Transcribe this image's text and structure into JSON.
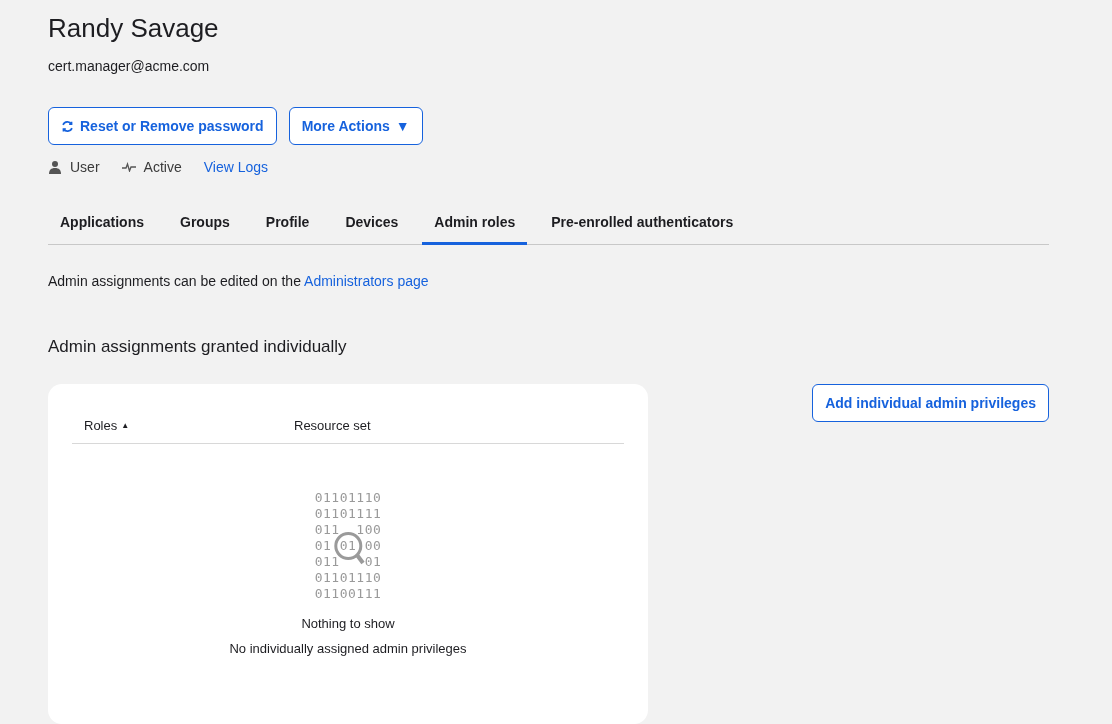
{
  "user": {
    "name": "Randy Savage",
    "email": "cert.manager@acme.com"
  },
  "actions": [
    {
      "kind": "reset",
      "label": "Reset or Remove password"
    },
    {
      "kind": "menu",
      "label": "More Actions",
      "caret": "▼"
    }
  ],
  "status": {
    "type": "User",
    "state": "Active",
    "logs_link": "View Logs"
  },
  "tabs": [
    {
      "label": "Applications",
      "selected": false
    },
    {
      "label": "Groups",
      "selected": false
    },
    {
      "label": "Profile",
      "selected": false
    },
    {
      "label": "Devices",
      "selected": false
    },
    {
      "label": "Admin roles",
      "selected": true
    },
    {
      "label": "Pre-enrolled authenticators",
      "selected": false
    }
  ],
  "notice": {
    "text": "Admin assignments can be edited on the ",
    "link": "Administrators page"
  },
  "section": {
    "title": "Admin assignments granted individually",
    "add_button": "Add individual admin privileges"
  },
  "table": {
    "columns": [
      {
        "label": "Roles",
        "sort": "▲"
      },
      {
        "label": "Resource set"
      }
    ],
    "empty": {
      "binary": [
        "01101110",
        "01101111",
        "011  100",
        "01 01 00",
        "011   01",
        "01101110",
        "01100111"
      ],
      "title": "Nothing to show",
      "message": "No individually assigned admin privileges"
    }
  }
}
